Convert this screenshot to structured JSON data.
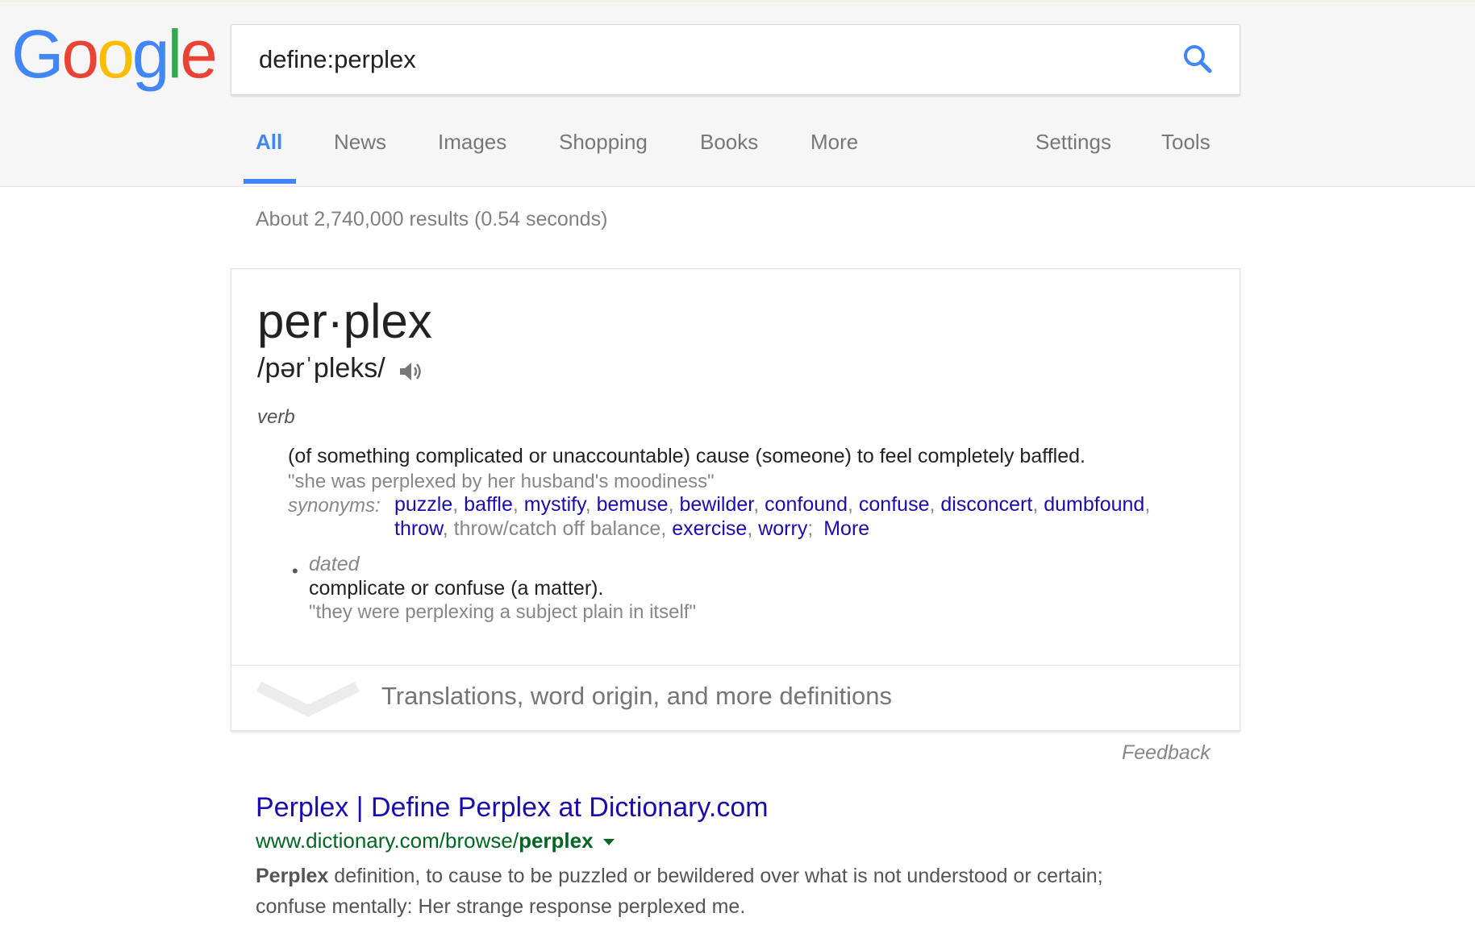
{
  "search": {
    "query": "define:perplex"
  },
  "tabs": [
    {
      "label": "All",
      "active": true
    },
    {
      "label": "News"
    },
    {
      "label": "Images"
    },
    {
      "label": "Shopping"
    },
    {
      "label": "Books"
    },
    {
      "label": "More"
    },
    {
      "label": "Settings"
    },
    {
      "label": "Tools"
    }
  ],
  "stats": "About 2,740,000 results (0.54 seconds)",
  "definition": {
    "word": "per·plex",
    "phonetic": "/pərˈpleks/",
    "part_of_speech": "verb",
    "sense1": {
      "definition": "(of something complicated or unaccountable) cause (someone) to feel completely baffled.",
      "example": "\"she was perplexed by her husband's moodiness\"",
      "synonyms_label": "synonyms:",
      "synonyms_line1": [
        {
          "text": "puzzle",
          "link": true
        },
        {
          "text": "baffle",
          "link": true
        },
        {
          "text": "mystify",
          "link": true
        },
        {
          "text": "bemuse",
          "link": true
        },
        {
          "text": "bewilder",
          "link": true
        },
        {
          "text": "confound",
          "link": true
        },
        {
          "text": "confuse",
          "link": true
        },
        {
          "text": "disconcert",
          "link": true
        },
        {
          "text": "dumbfound",
          "link": true
        }
      ],
      "synonyms_line2": [
        {
          "text": "throw",
          "link": true
        },
        {
          "text": "throw/catch off balance",
          "link": false
        },
        {
          "text": "exercise",
          "link": true
        },
        {
          "text": "worry",
          "link": true
        }
      ],
      "more_label": "More"
    },
    "sense2": {
      "register": "dated",
      "definition": "complicate or confuse (a matter).",
      "example": "\"they were perplexing a subject plain in itself\""
    },
    "more_definitions": "Translations, word origin, and more definitions"
  },
  "feedback": "Feedback",
  "result": {
    "title": "Perplex | Define Perplex at Dictionary.com",
    "url_prefix": "www.dictionary.com/browse/",
    "url_bold": "perplex",
    "snippet_line1_bold": "Perplex",
    "snippet_line1_rest": " definition, to cause to be puzzled or bewildered over what is not understood or certain;",
    "snippet_line2": "confuse mentally: Her strange response perplexed me."
  },
  "colors": {
    "link": "#1a0dab",
    "accent": "#4285f4",
    "url_green": "#006621"
  }
}
